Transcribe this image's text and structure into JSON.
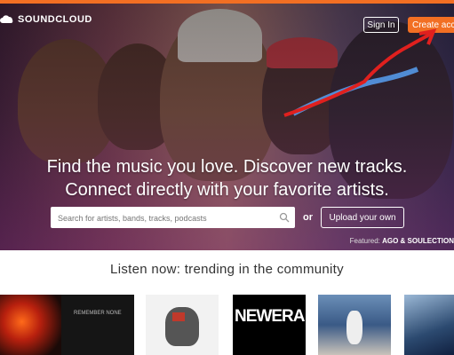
{
  "brand": {
    "logo_text": "SOUNDCLOUD"
  },
  "header": {
    "sign_in": "Sign In",
    "create_account": "Create account"
  },
  "hero": {
    "headline_line1": "Find the music you love. Discover new tracks.",
    "headline_line2": "Connect directly with your favorite artists.",
    "search_placeholder": "Search for artists, bands, tracks, podcasts",
    "or_text": "or",
    "upload_label": "Upload your own",
    "featured_label": "Featured:",
    "featured_artists": "AGO & SOULECTION"
  },
  "trending": {
    "heading": "Listen now: trending in the community",
    "tiles": [
      {
        "art": "red-flame-art",
        "caption": ""
      },
      {
        "art": "dark-text-art",
        "caption": "REMEMBER NONE"
      },
      {
        "art": "sketch-figure-art",
        "caption": ""
      },
      {
        "art": "newera-text-art",
        "caption": "NEWERA"
      },
      {
        "art": "stadium-photo-art",
        "caption": ""
      },
      {
        "art": "blue-poster-art",
        "caption": ""
      }
    ]
  },
  "colors": {
    "brand_orange": "#f26f23",
    "annotation_red": "#e0201e",
    "annotation_blue": "#5aa8ff"
  }
}
